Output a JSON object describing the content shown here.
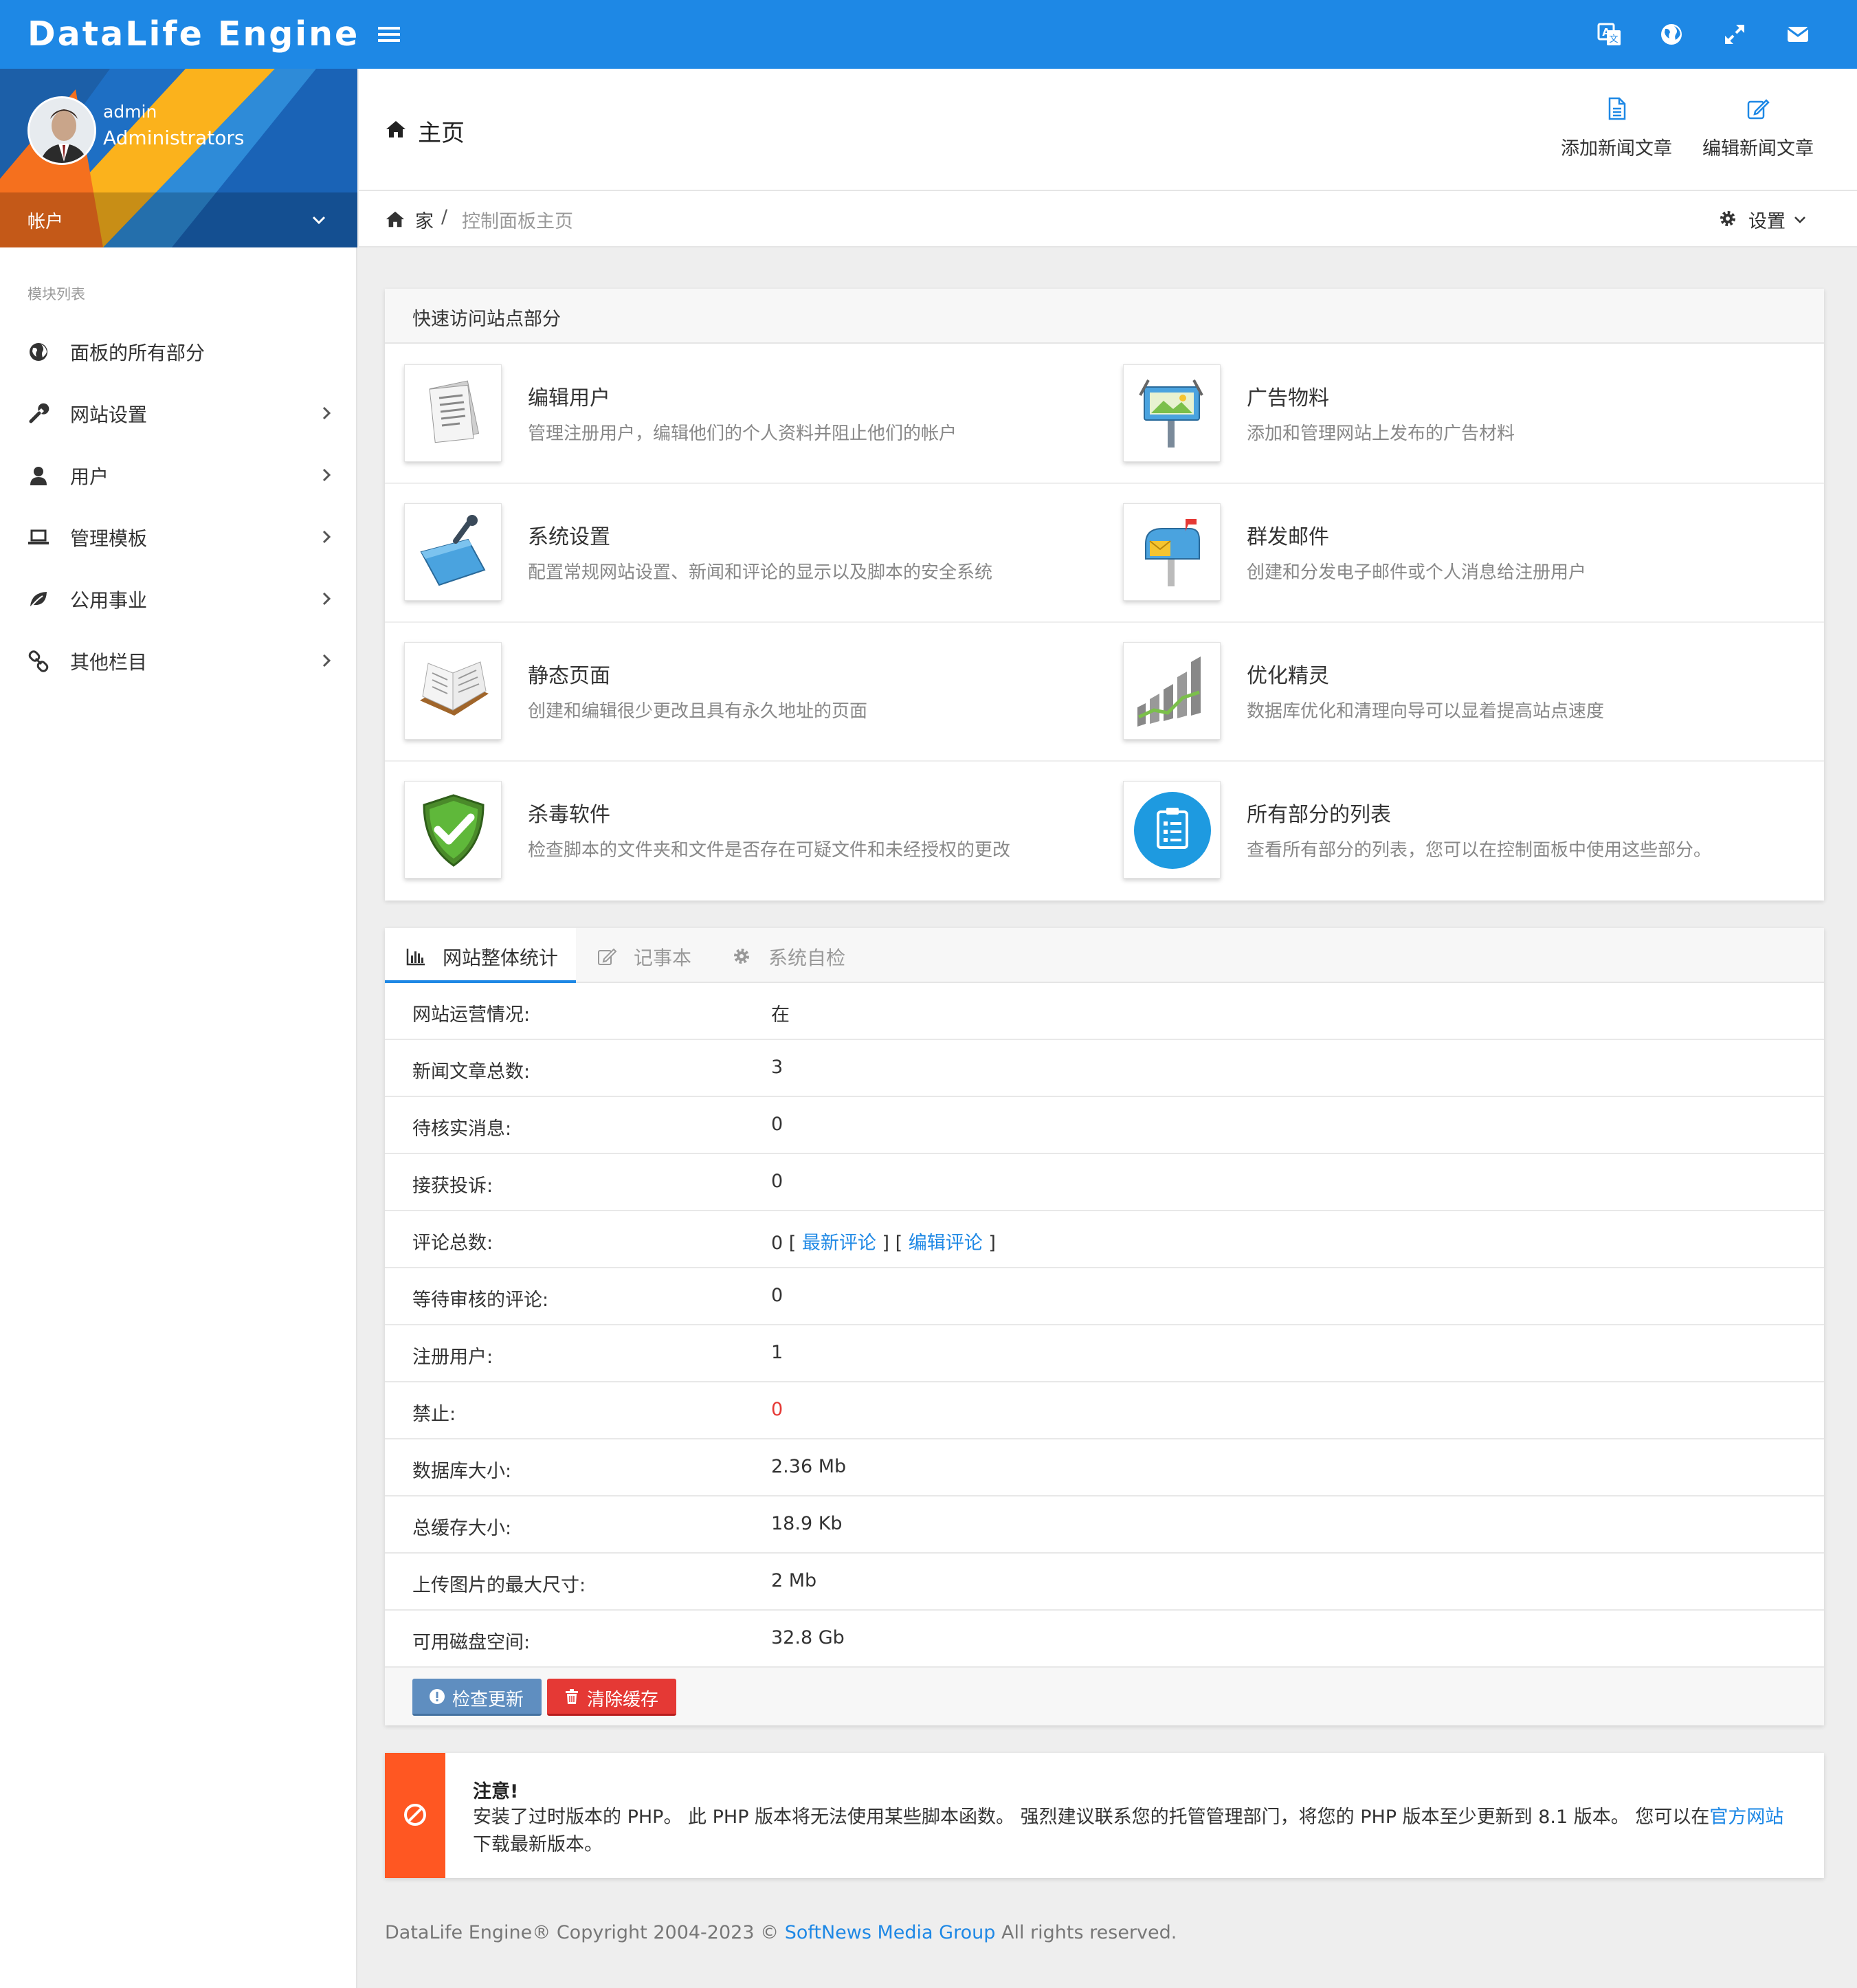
{
  "app": {
    "brand": "DataLife Engine"
  },
  "user": {
    "name": "admin",
    "role": "Administrators",
    "account_label": "帐户"
  },
  "sidebar": {
    "modules_label": "模块列表",
    "items": [
      {
        "label": "面板的所有部分",
        "icon": "globe-icon"
      },
      {
        "label": "网站设置",
        "icon": "wrench-icon"
      },
      {
        "label": "用户",
        "icon": "user-icon"
      },
      {
        "label": "管理模板",
        "icon": "laptop-icon"
      },
      {
        "label": "公用事业",
        "icon": "leaf-icon"
      },
      {
        "label": "其他栏目",
        "icon": "link-icon"
      }
    ]
  },
  "header": {
    "title": "主页",
    "buttons": [
      {
        "label": "添加新闻文章",
        "icon": "file-icon"
      },
      {
        "label": "编辑新闻文章",
        "icon": "edit-icon"
      }
    ]
  },
  "breadcrumb": {
    "home": "家",
    "separator": "/",
    "current": "控制面板主页",
    "settings": "设置"
  },
  "quick_access": {
    "title": "快速访问站点部分",
    "items": [
      {
        "title": "编辑用户",
        "desc": "管理注册用户，编辑他们的个人资料并阻止他们的帐户"
      },
      {
        "title": "广告物料",
        "desc": "添加和管理网站上发布的广告材料"
      },
      {
        "title": "系统设置",
        "desc": "配置常规网站设置、新闻和评论的显示以及脚本的安全系统"
      },
      {
        "title": "群发邮件",
        "desc": "创建和分发电子邮件或个人消息给注册用户"
      },
      {
        "title": "静态页面",
        "desc": "创建和编辑很少更改且具有永久地址的页面"
      },
      {
        "title": "优化精灵",
        "desc": "数据库优化和清理向导可以显着提高站点速度"
      },
      {
        "title": "杀毒软件",
        "desc": "检查脚本的文件夹和文件是否存在可疑文件和未经授权的更改"
      },
      {
        "title": "所有部分的列表",
        "desc": "查看所有部分的列表，您可以在控制面板中使用这些部分。"
      }
    ]
  },
  "tabs": [
    {
      "label": "网站整体统计",
      "active": true
    },
    {
      "label": "记事本",
      "active": false
    },
    {
      "label": "系统自检",
      "active": false
    }
  ],
  "stats": [
    {
      "label": "网站运营情况:",
      "value": "在"
    },
    {
      "label": "新闻文章总数:",
      "value": "3"
    },
    {
      "label": "待核实消息:",
      "value": "0"
    },
    {
      "label": "接获投诉:",
      "value": "0"
    },
    {
      "label": "评论总数:",
      "value": "0"
    },
    {
      "label": "等待审核的评论:",
      "value": "0"
    },
    {
      "label": "注册用户:",
      "value": "1"
    },
    {
      "label": "禁止:",
      "value": "0"
    },
    {
      "label": "数据库大小:",
      "value": "2.36 Mb"
    },
    {
      "label": "总缓存大小:",
      "value": "18.9 Kb"
    },
    {
      "label": "上传图片的最大尺寸:",
      "value": "2 Mb"
    },
    {
      "label": "可用磁盘空间:",
      "value": "32.8 Gb"
    }
  ],
  "comments_links": {
    "open": "[",
    "latest": "最新评论",
    "mid": "] [",
    "edit": "编辑评论",
    "close": "]"
  },
  "actions": {
    "check_update": "检查更新",
    "clear_cache": "清除缓存"
  },
  "warning": {
    "title": "注意!",
    "text": "安装了过时版本的 PHP。 此 PHP 版本将无法使用某些脚本函数。 强烈建议联系您的托管管理部门，将您的 PHP 版本至少更新到 8.1 版本。 您可以在",
    "link": "官方网站",
    "text_after": "下载最新版本。"
  },
  "footer": {
    "prefix": "DataLife Engine® Copyright 2004-2023 ©",
    "link": "SoftNews Media Group",
    "suffix": "All rights reserved."
  },
  "colors": {
    "primary": "#1e88e5",
    "danger": "#e53935",
    "warning": "#ff5722",
    "update_button": "#5f8ec0",
    "banned_value": "#e53935"
  }
}
